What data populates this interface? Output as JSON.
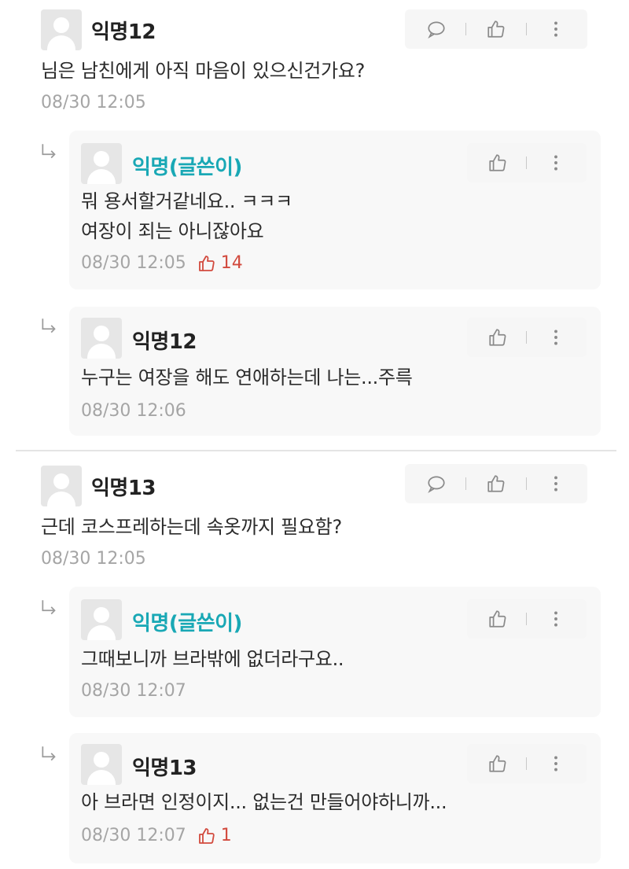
{
  "colors": {
    "op_name": "#19a8b5",
    "like_count": "#d24a3e",
    "timestamp": "#a5a5a5",
    "reply_bg": "#f8f8f8",
    "action_bg": "#f6f6f6"
  },
  "icons": {
    "reply": "speech-bubble-icon",
    "like": "thumbs-up-icon",
    "more": "more-vertical-icon",
    "nested_reply": "reply-arrow-icon",
    "avatar": "default-avatar-icon"
  },
  "threads": [
    {
      "author": "익명12",
      "text": "님은 남친에게 아직 마음이 있으신건가요?",
      "time": "08/30 12:05",
      "replies": [
        {
          "author": "익명(글쓴이)",
          "lines": [
            "뭐 용서할거같네요.. ㅋㅋㅋ",
            "여장이 죄는 아니잖아요"
          ],
          "time": "08/30 12:05",
          "likes": "14"
        },
        {
          "author": "익명12",
          "lines": [
            "누구는 여장을 해도 연애하는데 나는...주륵"
          ],
          "time": "08/30 12:06"
        }
      ]
    },
    {
      "author": "익명13",
      "text": "근데 코스프레하는데 속옷까지 필요함?",
      "time": "08/30 12:05",
      "replies": [
        {
          "author": "익명(글쓴이)",
          "lines": [
            "그때보니까 브라밖에 없더라구요.."
          ],
          "time": "08/30 12:07"
        },
        {
          "author": "익명13",
          "lines": [
            "아 브라면 인정이지... 없는건 만들어야하니까..."
          ],
          "time": "08/30 12:07",
          "likes": "1"
        }
      ]
    }
  ]
}
